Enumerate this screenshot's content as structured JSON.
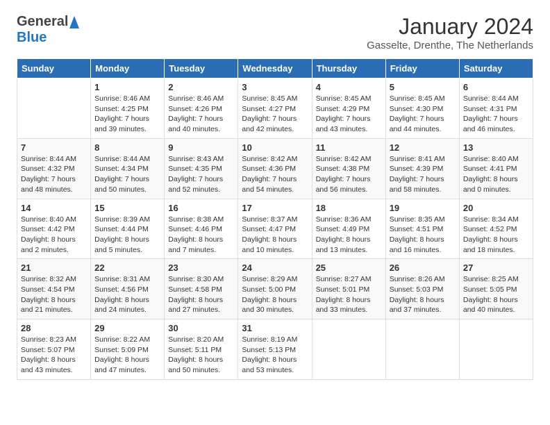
{
  "header": {
    "logo_general": "General",
    "logo_blue": "Blue",
    "month_title": "January 2024",
    "subtitle": "Gasselte, Drenthe, The Netherlands"
  },
  "weekdays": [
    "Sunday",
    "Monday",
    "Tuesday",
    "Wednesday",
    "Thursday",
    "Friday",
    "Saturday"
  ],
  "weeks": [
    [
      {
        "day": "",
        "sunrise": "",
        "sunset": "",
        "daylight": ""
      },
      {
        "day": "1",
        "sunrise": "Sunrise: 8:46 AM",
        "sunset": "Sunset: 4:25 PM",
        "daylight": "Daylight: 7 hours and 39 minutes."
      },
      {
        "day": "2",
        "sunrise": "Sunrise: 8:46 AM",
        "sunset": "Sunset: 4:26 PM",
        "daylight": "Daylight: 7 hours and 40 minutes."
      },
      {
        "day": "3",
        "sunrise": "Sunrise: 8:45 AM",
        "sunset": "Sunset: 4:27 PM",
        "daylight": "Daylight: 7 hours and 42 minutes."
      },
      {
        "day": "4",
        "sunrise": "Sunrise: 8:45 AM",
        "sunset": "Sunset: 4:29 PM",
        "daylight": "Daylight: 7 hours and 43 minutes."
      },
      {
        "day": "5",
        "sunrise": "Sunrise: 8:45 AM",
        "sunset": "Sunset: 4:30 PM",
        "daylight": "Daylight: 7 hours and 44 minutes."
      },
      {
        "day": "6",
        "sunrise": "Sunrise: 8:44 AM",
        "sunset": "Sunset: 4:31 PM",
        "daylight": "Daylight: 7 hours and 46 minutes."
      }
    ],
    [
      {
        "day": "7",
        "sunrise": "Sunrise: 8:44 AM",
        "sunset": "Sunset: 4:32 PM",
        "daylight": "Daylight: 7 hours and 48 minutes."
      },
      {
        "day": "8",
        "sunrise": "Sunrise: 8:44 AM",
        "sunset": "Sunset: 4:34 PM",
        "daylight": "Daylight: 7 hours and 50 minutes."
      },
      {
        "day": "9",
        "sunrise": "Sunrise: 8:43 AM",
        "sunset": "Sunset: 4:35 PM",
        "daylight": "Daylight: 7 hours and 52 minutes."
      },
      {
        "day": "10",
        "sunrise": "Sunrise: 8:42 AM",
        "sunset": "Sunset: 4:36 PM",
        "daylight": "Daylight: 7 hours and 54 minutes."
      },
      {
        "day": "11",
        "sunrise": "Sunrise: 8:42 AM",
        "sunset": "Sunset: 4:38 PM",
        "daylight": "Daylight: 7 hours and 56 minutes."
      },
      {
        "day": "12",
        "sunrise": "Sunrise: 8:41 AM",
        "sunset": "Sunset: 4:39 PM",
        "daylight": "Daylight: 7 hours and 58 minutes."
      },
      {
        "day": "13",
        "sunrise": "Sunrise: 8:40 AM",
        "sunset": "Sunset: 4:41 PM",
        "daylight": "Daylight: 8 hours and 0 minutes."
      }
    ],
    [
      {
        "day": "14",
        "sunrise": "Sunrise: 8:40 AM",
        "sunset": "Sunset: 4:42 PM",
        "daylight": "Daylight: 8 hours and 2 minutes."
      },
      {
        "day": "15",
        "sunrise": "Sunrise: 8:39 AM",
        "sunset": "Sunset: 4:44 PM",
        "daylight": "Daylight: 8 hours and 5 minutes."
      },
      {
        "day": "16",
        "sunrise": "Sunrise: 8:38 AM",
        "sunset": "Sunset: 4:46 PM",
        "daylight": "Daylight: 8 hours and 7 minutes."
      },
      {
        "day": "17",
        "sunrise": "Sunrise: 8:37 AM",
        "sunset": "Sunset: 4:47 PM",
        "daylight": "Daylight: 8 hours and 10 minutes."
      },
      {
        "day": "18",
        "sunrise": "Sunrise: 8:36 AM",
        "sunset": "Sunset: 4:49 PM",
        "daylight": "Daylight: 8 hours and 13 minutes."
      },
      {
        "day": "19",
        "sunrise": "Sunrise: 8:35 AM",
        "sunset": "Sunset: 4:51 PM",
        "daylight": "Daylight: 8 hours and 16 minutes."
      },
      {
        "day": "20",
        "sunrise": "Sunrise: 8:34 AM",
        "sunset": "Sunset: 4:52 PM",
        "daylight": "Daylight: 8 hours and 18 minutes."
      }
    ],
    [
      {
        "day": "21",
        "sunrise": "Sunrise: 8:32 AM",
        "sunset": "Sunset: 4:54 PM",
        "daylight": "Daylight: 8 hours and 21 minutes."
      },
      {
        "day": "22",
        "sunrise": "Sunrise: 8:31 AM",
        "sunset": "Sunset: 4:56 PM",
        "daylight": "Daylight: 8 hours and 24 minutes."
      },
      {
        "day": "23",
        "sunrise": "Sunrise: 8:30 AM",
        "sunset": "Sunset: 4:58 PM",
        "daylight": "Daylight: 8 hours and 27 minutes."
      },
      {
        "day": "24",
        "sunrise": "Sunrise: 8:29 AM",
        "sunset": "Sunset: 5:00 PM",
        "daylight": "Daylight: 8 hours and 30 minutes."
      },
      {
        "day": "25",
        "sunrise": "Sunrise: 8:27 AM",
        "sunset": "Sunset: 5:01 PM",
        "daylight": "Daylight: 8 hours and 33 minutes."
      },
      {
        "day": "26",
        "sunrise": "Sunrise: 8:26 AM",
        "sunset": "Sunset: 5:03 PM",
        "daylight": "Daylight: 8 hours and 37 minutes."
      },
      {
        "day": "27",
        "sunrise": "Sunrise: 8:25 AM",
        "sunset": "Sunset: 5:05 PM",
        "daylight": "Daylight: 8 hours and 40 minutes."
      }
    ],
    [
      {
        "day": "28",
        "sunrise": "Sunrise: 8:23 AM",
        "sunset": "Sunset: 5:07 PM",
        "daylight": "Daylight: 8 hours and 43 minutes."
      },
      {
        "day": "29",
        "sunrise": "Sunrise: 8:22 AM",
        "sunset": "Sunset: 5:09 PM",
        "daylight": "Daylight: 8 hours and 47 minutes."
      },
      {
        "day": "30",
        "sunrise": "Sunrise: 8:20 AM",
        "sunset": "Sunset: 5:11 PM",
        "daylight": "Daylight: 8 hours and 50 minutes."
      },
      {
        "day": "31",
        "sunrise": "Sunrise: 8:19 AM",
        "sunset": "Sunset: 5:13 PM",
        "daylight": "Daylight: 8 hours and 53 minutes."
      },
      {
        "day": "",
        "sunrise": "",
        "sunset": "",
        "daylight": ""
      },
      {
        "day": "",
        "sunrise": "",
        "sunset": "",
        "daylight": ""
      },
      {
        "day": "",
        "sunrise": "",
        "sunset": "",
        "daylight": ""
      }
    ]
  ]
}
